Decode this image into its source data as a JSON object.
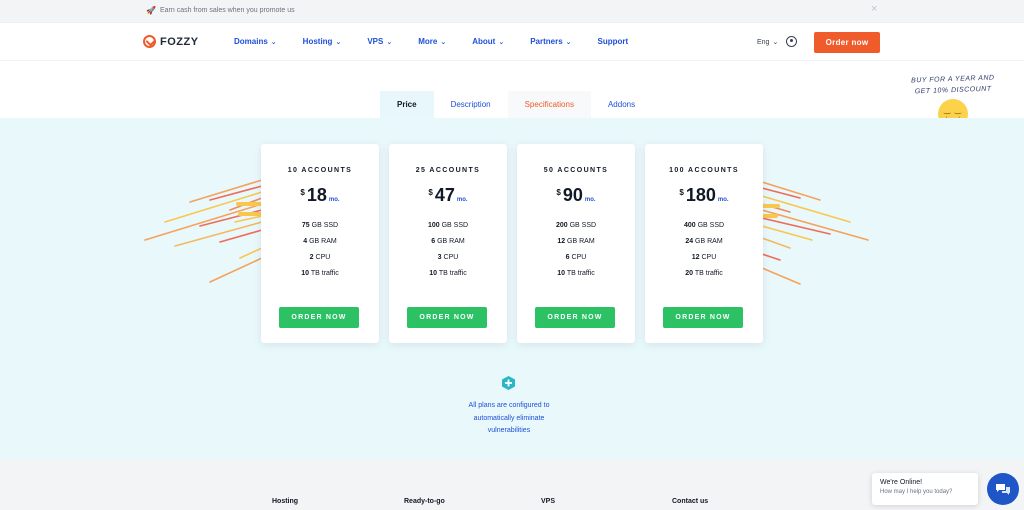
{
  "promo": {
    "text": "Earn cash from sales when you promote us",
    "close": "×"
  },
  "nav": {
    "logo": "FOZZY",
    "items": [
      {
        "label": "Domains",
        "chevron": true
      },
      {
        "label": "Hosting",
        "chevron": true
      },
      {
        "label": "VPS",
        "chevron": true
      },
      {
        "label": "More",
        "chevron": true
      },
      {
        "label": "About",
        "chevron": true
      },
      {
        "label": "Partners",
        "chevron": true
      },
      {
        "label": "Support",
        "chevron": false
      }
    ],
    "lang": "Eng",
    "order_label": "Order now"
  },
  "tabs": [
    {
      "label": "Price"
    },
    {
      "label": "Description"
    },
    {
      "label": "Specifications"
    },
    {
      "label": "Addons"
    }
  ],
  "discount_note": "BUY FOR A YEAR AND GET 10% DISCOUNT",
  "plans": [
    {
      "title": "10 ACCOUNTS",
      "currency": "$",
      "price": "18",
      "period": "mo.",
      "specs": [
        {
          "bold": "75",
          "rest": " GB SSD"
        },
        {
          "bold": "4",
          "rest": " GB RAM"
        },
        {
          "bold": "2",
          "rest": " CPU"
        },
        {
          "bold": "10",
          "rest": " TB traffic"
        }
      ],
      "button": "ORDER NOW"
    },
    {
      "title": "25 ACCOUNTS",
      "currency": "$",
      "price": "47",
      "period": "mo.",
      "specs": [
        {
          "bold": "100",
          "rest": " GB SSD"
        },
        {
          "bold": "6",
          "rest": " GB RAM"
        },
        {
          "bold": "3",
          "rest": " CPU"
        },
        {
          "bold": "10",
          "rest": " TB traffic"
        }
      ],
      "button": "ORDER NOW"
    },
    {
      "title": "50 ACCOUNTS",
      "currency": "$",
      "price": "90",
      "period": "mo.",
      "specs": [
        {
          "bold": "200",
          "rest": " GB SSD"
        },
        {
          "bold": "12",
          "rest": " GB RAM"
        },
        {
          "bold": "6",
          "rest": " CPU"
        },
        {
          "bold": "10",
          "rest": " TB traffic"
        }
      ],
      "button": "ORDER NOW"
    },
    {
      "title": "100 ACCOUNTS",
      "currency": "$",
      "price": "180",
      "period": "mo.",
      "specs": [
        {
          "bold": "400",
          "rest": " GB SSD"
        },
        {
          "bold": "24",
          "rest": " GB RAM"
        },
        {
          "bold": "12",
          "rest": " CPU"
        },
        {
          "bold": "20",
          "rest": " TB traffic"
        }
      ],
      "button": "ORDER NOW"
    }
  ],
  "security": {
    "line1": "All plans are configured to",
    "line2": "automatically eliminate",
    "line3": "vulnerabilities"
  },
  "footer": {
    "columns": [
      "Hosting",
      "Ready-to-go",
      "VPS",
      "Contact us"
    ]
  },
  "chat": {
    "title": "We're Online!",
    "subtitle": "How may I help you today?"
  },
  "colors": {
    "accent": "#ef5b2b",
    "link": "#1e4fd8",
    "green": "#2cc264",
    "panel": "#e9f8fb"
  }
}
